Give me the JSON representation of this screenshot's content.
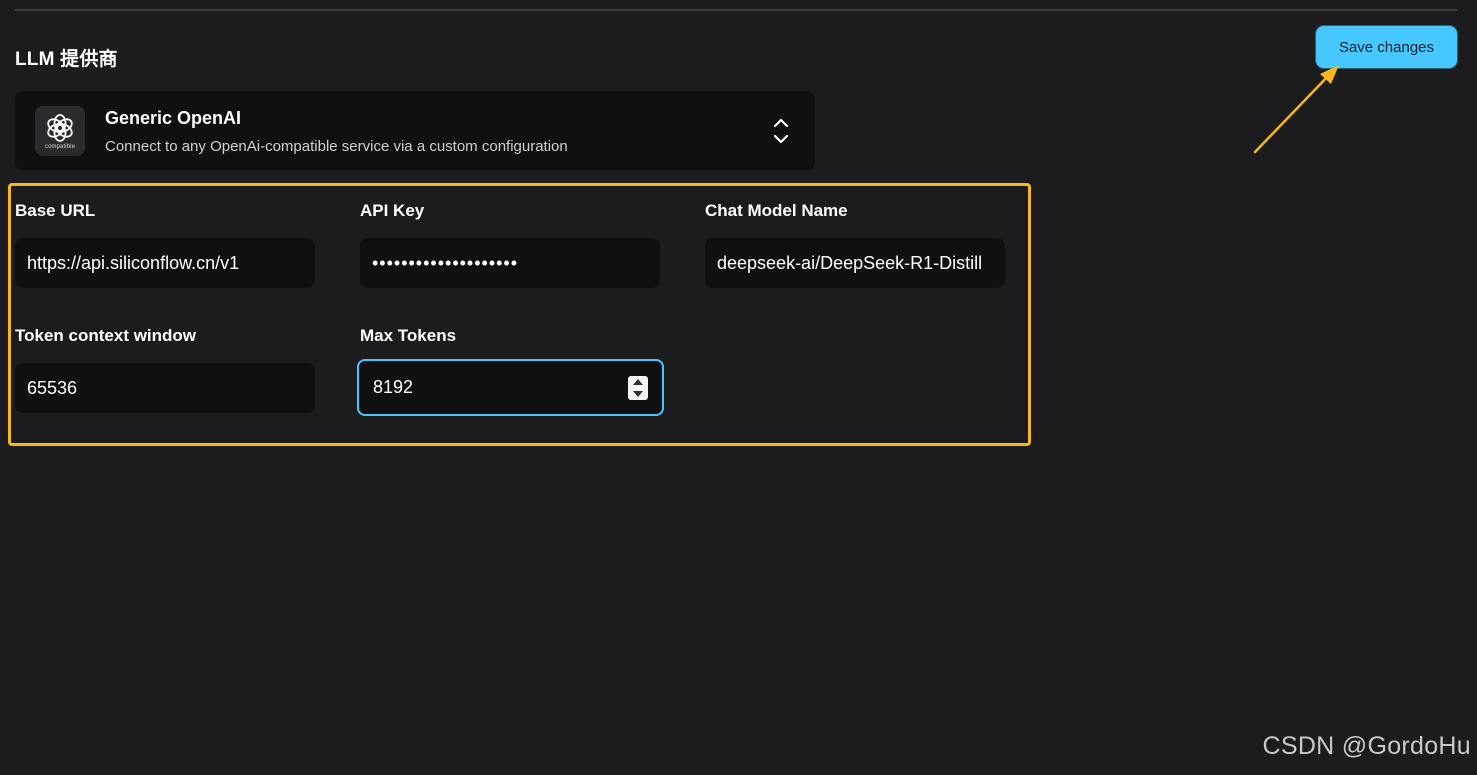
{
  "section": {
    "title": "LLM 提供商"
  },
  "toolbar": {
    "save_label": "Save changes"
  },
  "provider": {
    "name": "Generic OpenAI",
    "description": "Connect to any OpenAi-compatible service via a custom configuration",
    "logo_caption": "compatible",
    "logo_icon": "openai-logo-icon",
    "toggle_icon": "chevron-up-down-icon"
  },
  "fields": {
    "base_url": {
      "label": "Base URL",
      "value": "https://api.siliconflow.cn/v1"
    },
    "api_key": {
      "label": "API Key",
      "value": "••••••••••••••••••••"
    },
    "chat_model": {
      "label": "Chat Model Name",
      "value": "deepseek-ai/DeepSeek-R1-Distill"
    },
    "context_window": {
      "label": "Token context window",
      "value": "65536"
    },
    "max_tokens": {
      "label": "Max Tokens",
      "value": "8192"
    }
  },
  "watermark": "CSDN @GordoHu",
  "colors": {
    "background": "#1c1c1f",
    "accent": "#46c8ff",
    "highlight": "#f8b81a",
    "input_bg": "#0f1011"
  }
}
